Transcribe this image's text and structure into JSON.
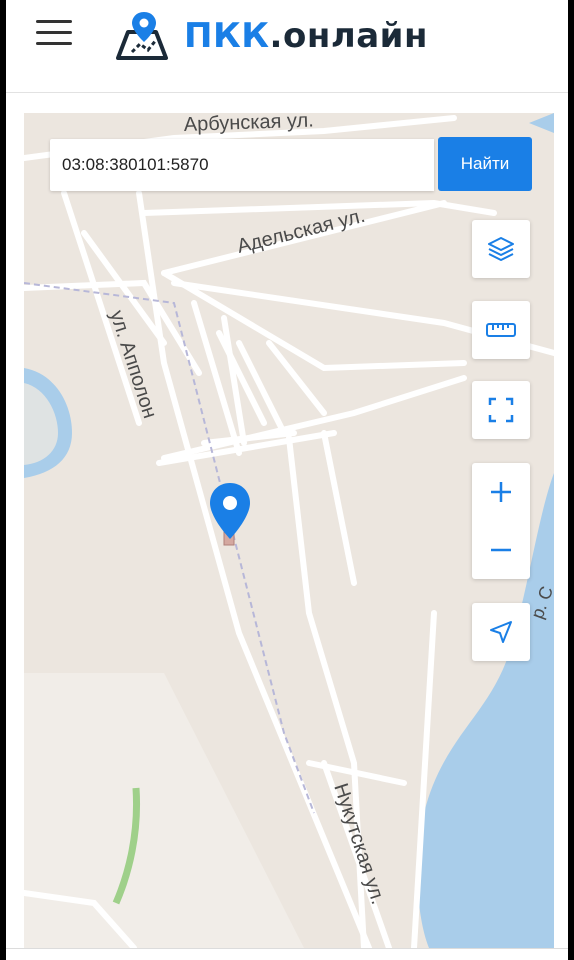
{
  "header": {
    "menu_icon": "hamburger-menu-icon",
    "logo_icon": "map-pin-logo-icon",
    "brand_main": "ПКК",
    "brand_suffix": ".онлайн"
  },
  "search": {
    "value": "03:08:380101:5870",
    "button_label": "Найти"
  },
  "map_controls": [
    {
      "name": "layers-icon"
    },
    {
      "name": "ruler-icon"
    },
    {
      "name": "fullscreen-icon"
    },
    {
      "name": "zoom-in-icon"
    },
    {
      "name": "zoom-out-icon"
    },
    {
      "name": "locate-icon"
    }
  ],
  "map_labels": {
    "street_1": "Арбунская ул.",
    "street_2": "Адельская ул.",
    "street_3": "ул. Апполон",
    "street_4": "Нукутская ул.",
    "river": "р. С"
  },
  "colors": {
    "accent": "#1a7fe6",
    "brand_dark": "#1b2a38",
    "map_land": "#ece6df",
    "water": "#a9cdea",
    "road": "#ffffff"
  }
}
